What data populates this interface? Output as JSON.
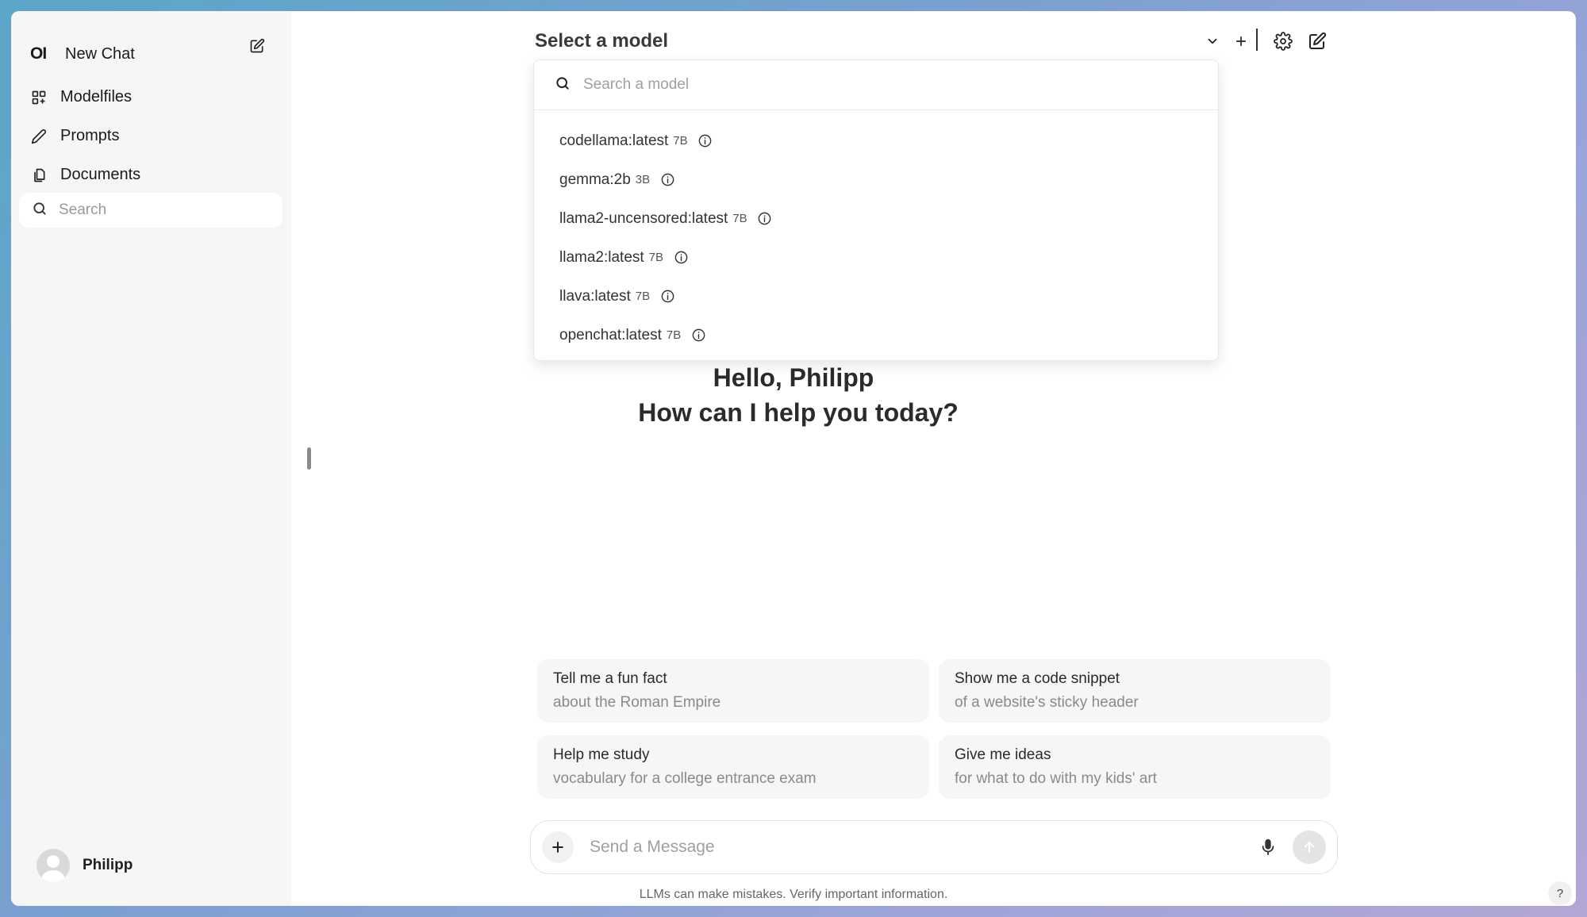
{
  "sidebar": {
    "logo": "OI",
    "new_chat": "New Chat",
    "items": [
      {
        "label": "Modelfiles",
        "icon": "grid-icon"
      },
      {
        "label": "Prompts",
        "icon": "pencil-icon"
      },
      {
        "label": "Documents",
        "icon": "documents-icon"
      }
    ],
    "search_placeholder": "Search",
    "user_name": "Philipp"
  },
  "header": {
    "title": "Select a model"
  },
  "model_dropdown": {
    "search_placeholder": "Search a model",
    "models": [
      {
        "name": "codellama:latest",
        "size": "7B"
      },
      {
        "name": "gemma:2b",
        "size": "3B"
      },
      {
        "name": "llama2-uncensored:latest",
        "size": "7B"
      },
      {
        "name": "llama2:latest",
        "size": "7B"
      },
      {
        "name": "llava:latest",
        "size": "7B"
      },
      {
        "name": "openchat:latest",
        "size": "7B"
      }
    ]
  },
  "greeting": {
    "line1": "Hello, Philipp",
    "line2": "How can I help you today?"
  },
  "suggestions": [
    {
      "title": "Tell me a fun fact",
      "subtitle": "about the Roman Empire"
    },
    {
      "title": "Show me a code snippet",
      "subtitle": "of a website's sticky header"
    },
    {
      "title": "Help me study",
      "subtitle": "vocabulary for a college entrance exam"
    },
    {
      "title": "Give me ideas",
      "subtitle": "for what to do with my kids' art"
    }
  ],
  "composer": {
    "placeholder": "Send a Message",
    "disclaimer": "LLMs can make mistakes. Verify important information.",
    "help": "?"
  }
}
